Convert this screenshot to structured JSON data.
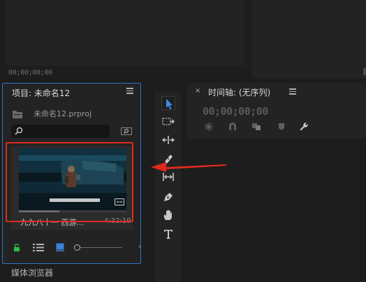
{
  "monitor": {
    "timecode": "00;00;00;00"
  },
  "project": {
    "title": "项目: 未命名12",
    "file_name": "未命名12.prproj",
    "search": {
      "placeholder": ""
    },
    "clip": {
      "name": "九九八十一 西游...",
      "duration": "4:32:19",
      "subtitle": "竟然在冰面上在那里吸收在流量"
    },
    "media_browser_label": "媒体浏览器"
  },
  "timeline": {
    "title": "时间轴: (无序列)",
    "timecode": "00;00;00;00"
  },
  "tools": [
    "selection",
    "track-select-forward",
    "ripple-edit",
    "razor",
    "slip",
    "pen",
    "hand",
    "type"
  ],
  "colors": {
    "accent": "#2e74c8",
    "annotation": "#e02a1e",
    "panel": "#232323"
  },
  "annotation": {
    "type": "arrow pointing to clip thumbnail"
  }
}
